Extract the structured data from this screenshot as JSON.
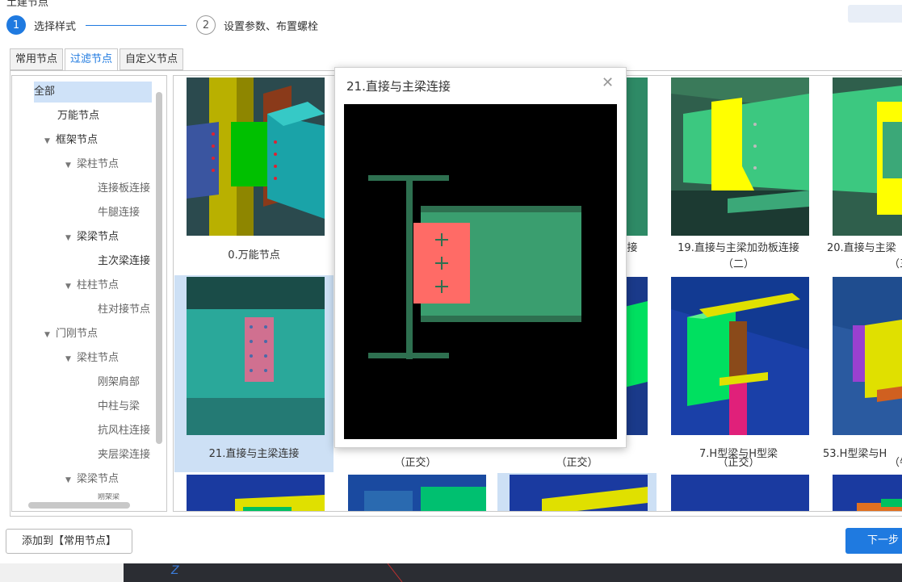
{
  "dialog": {
    "title": "土建节点"
  },
  "steps": [
    {
      "number": "1",
      "label": "选择样式"
    },
    {
      "number": "2",
      "label": "设置参数、布置螺栓"
    }
  ],
  "tabs": [
    "常用节点",
    "过滤节点",
    "自定义节点"
  ],
  "tree": {
    "items": [
      "全部",
      "万能节点",
      "框架节点",
      "梁柱节点",
      "连接板连接",
      "牛腿连接",
      "梁梁节点",
      "主次梁连接",
      "柱柱节点",
      "柱对接节点",
      "门刚节点",
      "梁柱节点",
      "刚架肩部",
      "中柱与梁",
      "抗风柱连接",
      "夹层梁连接",
      "梁梁节点",
      "刚架梁"
    ]
  },
  "grid": {
    "captions": [
      {
        "line1": "0.万能节点",
        "line2": ""
      },
      {
        "line1": "",
        "line2": ""
      },
      {
        "line1": "连接",
        "line2": ""
      },
      {
        "line1": "19.直接与主梁加劲板连接",
        "line2": "（二）"
      },
      {
        "line1": "20.直接与主梁",
        "line2": "（三"
      },
      {
        "line1": "21.直接与主梁连接",
        "line2": ""
      },
      {
        "line1": "",
        "line2": "（正交）"
      },
      {
        "line1": "",
        "line2": "（正交）"
      },
      {
        "line1": "7.H型梁与H型梁",
        "line2": "（正交）"
      },
      {
        "line1": "53.H型梁与H",
        "line2": "（牛"
      }
    ]
  },
  "popup": {
    "title": "21.直接与主梁连接",
    "close_glyph": "✕"
  },
  "footer": {
    "add_label": "添加到【常用节点】",
    "next_label": "下一步"
  },
  "bottom": {
    "glyph": "Z"
  },
  "colors": {
    "accent": "#1f7ae0",
    "steel_green": "#3a9e6f",
    "plate_red": "#ff6b66",
    "highlight_yellow": "#ffff00"
  }
}
